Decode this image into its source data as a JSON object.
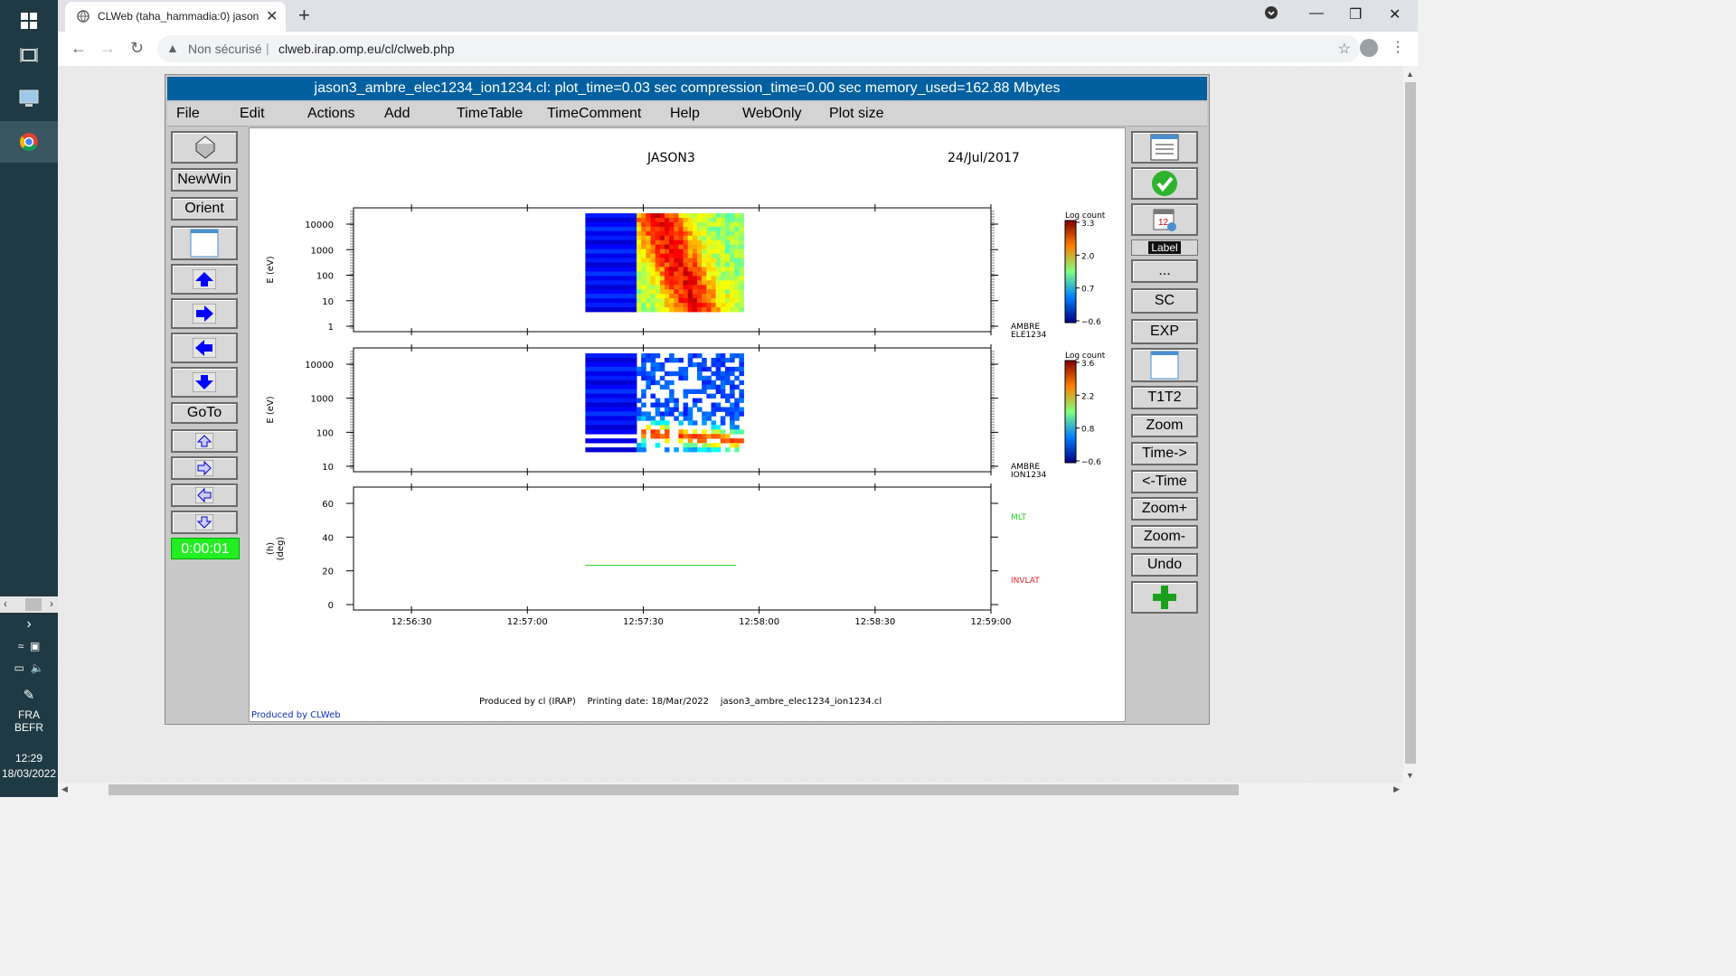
{
  "taskbar": {
    "language": "FRA",
    "keyboard": "BEFR",
    "time": "12:29",
    "date": "18/03/2022"
  },
  "browser": {
    "tab_title": "CLWeb (taha_hammadia:0) jason3_ambre_elec1234_ion1234.cl",
    "security_label": "Non sécurisé",
    "url": "clweb.irap.omp.eu/cl/clweb.php"
  },
  "app": {
    "title": "jason3_ambre_elec1234_ion1234.cl:    plot_time=0.03 sec  compression_time=0.00 sec  memory_used=162.88 Mbytes",
    "menu": [
      "File",
      "Edit",
      "Actions",
      "Add",
      "TimeTable",
      "TimeComment",
      "Help",
      "WebOnly",
      "Plot size"
    ],
    "left_buttons": {
      "newwin": "NewWin",
      "orient": "Orient",
      "goto": "GoTo",
      "clock": "0:00:01"
    },
    "right_buttons": {
      "label": "Label",
      "dots": "...",
      "sc": "SC",
      "exp": "EXP",
      "t1t2": "T1T2",
      "zoom": "Zoom",
      "time_fwd": "Time->",
      "time_back": "<-Time",
      "zoom_plus": "Zoom+",
      "zoom_minus": "Zoom-",
      "undo": "Undo"
    },
    "produced_by": "Produced by CLWeb"
  },
  "chart_data": {
    "type": "heatmap",
    "title_left": "JASON3",
    "title_right": "24/Jul/2017",
    "footer": "Produced by cl (IRAP)    Printing date: 18/Mar/2022    jason3_ambre_elec1234_ion1234.cl",
    "x_ticks": [
      "12:56:30",
      "12:57:00",
      "12:57:30",
      "12:58:00",
      "12:58:30",
      "12:59:00"
    ],
    "data_time_range": [
      "12:57:15",
      "12:57:56"
    ],
    "panels": [
      {
        "ylabel": "E (eV)",
        "y_scale": "log",
        "y_ticks": [
          "10000",
          "1000",
          "100",
          "10",
          "1"
        ],
        "colorbar_title": "Log count",
        "colorbar_ticks": [
          "3.3",
          "2.0",
          "0.7",
          "−0.6"
        ],
        "right_label": [
          "AMBRE",
          "ELE1234"
        ]
      },
      {
        "ylabel": "E (eV)",
        "y_scale": "log",
        "y_ticks": [
          "10000",
          "1000",
          "100",
          "10"
        ],
        "colorbar_title": "Log count",
        "colorbar_ticks": [
          "3.6",
          "2.2",
          "0.8",
          "−0.6"
        ],
        "right_label": [
          "AMBRE",
          "ION1234"
        ]
      },
      {
        "ylabel": "(h)\n(deg)",
        "y_ticks": [
          "60",
          "40",
          "20",
          "0"
        ],
        "ylim": [
          0,
          70
        ],
        "series": [
          {
            "name": "MLT",
            "color": "#22cc22",
            "x": [
              "12:57:15",
              "12:57:54"
            ],
            "y": [
              21,
              21
            ]
          },
          {
            "name": "INVLAT",
            "color": "#ee2222",
            "x": [],
            "y": []
          }
        ]
      }
    ]
  }
}
